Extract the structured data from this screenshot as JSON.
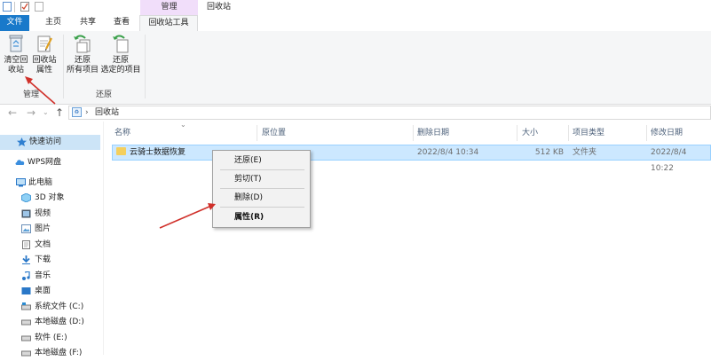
{
  "title_bar": {
    "context_tab_group": "管理",
    "window_title": "回收站"
  },
  "tabs": {
    "file": "文件",
    "home": "主页",
    "share": "共享",
    "view": "查看",
    "recycle_tools": "回收站工具"
  },
  "ribbon": {
    "manage_group": {
      "label": "管理",
      "empty_line1": "清空回",
      "empty_line2": "收站",
      "props_line1": "回收站",
      "props_line2": "属性"
    },
    "restore_group": {
      "label": "还原",
      "restore_all_line1": "还原",
      "restore_all_line2": "所有项目",
      "restore_sel_line1": "还原",
      "restore_sel_line2": "选定的项目"
    }
  },
  "address": {
    "location": "回收站"
  },
  "nav_pane": {
    "quick_access": "快速访问",
    "wps": "WPS网盘",
    "this_pc": "此电脑",
    "items": [
      "3D 对象",
      "视频",
      "图片",
      "文档",
      "下载",
      "音乐",
      "桌面",
      "系统文件 (C:)",
      "本地磁盘 (D:)",
      "软件 (E:)",
      "本地磁盘 (F:)"
    ]
  },
  "columns": {
    "name": "名称",
    "original_location": "原位置",
    "date_deleted": "删除日期",
    "size": "大小",
    "item_type": "项目类型",
    "date_modified": "修改日期"
  },
  "row": {
    "name": "云骑士数据恢复",
    "original_location": "",
    "date_deleted": "2022/8/4 10:34",
    "size": "512 KB",
    "item_type": "文件夹",
    "date_modified": "2022/8/4 10:22"
  },
  "context_menu": {
    "restore": "还原(E)",
    "cut": "剪切(T)",
    "delete": "删除(D)",
    "properties": "属性(R)"
  },
  "colors": {
    "accent": "#1979ca",
    "selection": "#cce8ff",
    "context_tab": "#f1defa",
    "annotation_arrow": "#d0302a"
  }
}
